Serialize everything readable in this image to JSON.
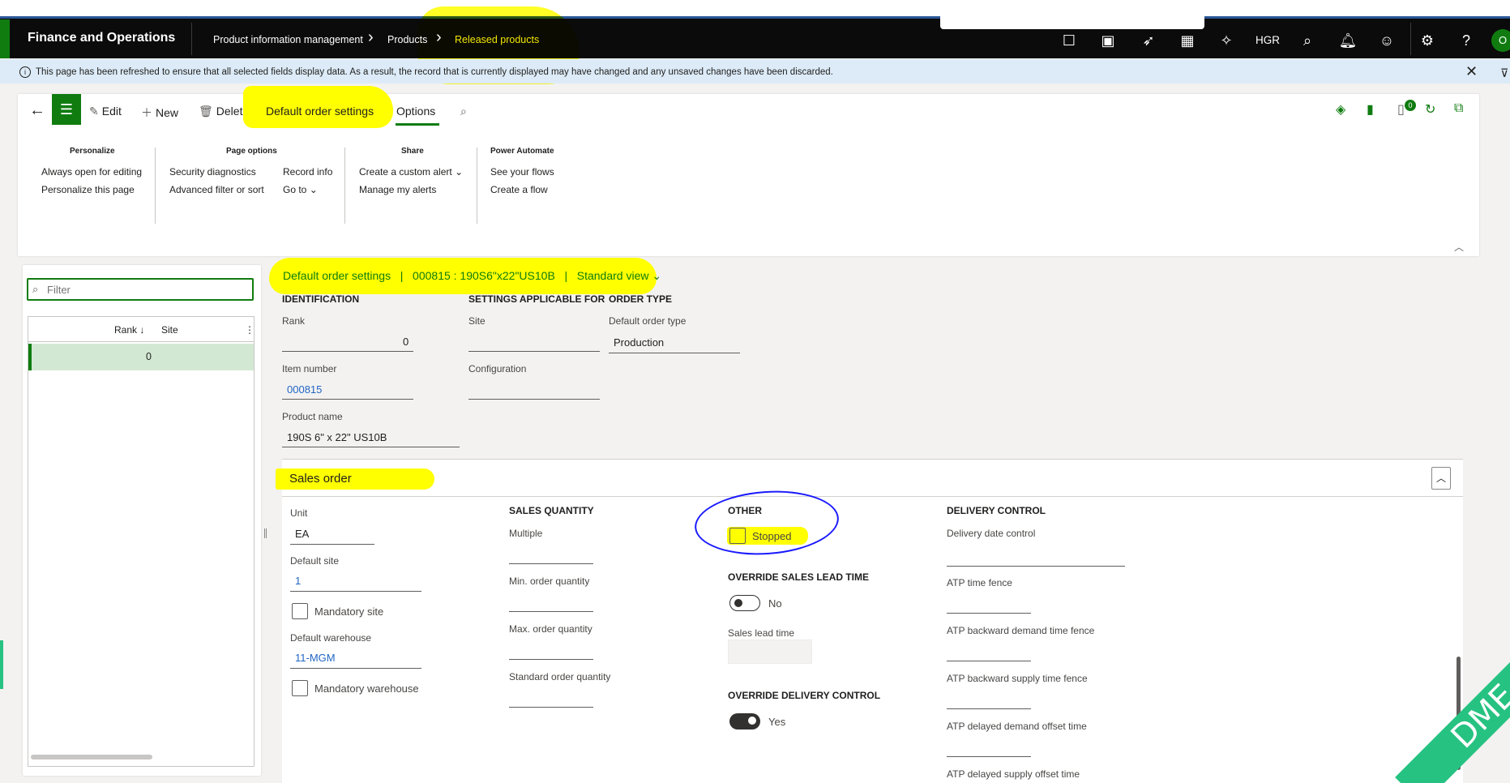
{
  "app": {
    "title": "Finance and Operations"
  },
  "breadcrumb": [
    {
      "label": "Product information management"
    },
    {
      "label": "Products"
    },
    {
      "label": "Released products"
    }
  ],
  "topbar": {
    "company": "HGR",
    "avatar": "O"
  },
  "infobar": {
    "message": "This page has been refreshed to ensure that all selected fields display data. As a result, the record that is currently displayed may have changed and any unsaved changes have been discarded."
  },
  "actionpane": {
    "edit": "Edit",
    "new": "New",
    "delete": "Delete",
    "tab_default_order_settings": "Default order settings",
    "tab_options": "Options",
    "badge": "0",
    "groups": {
      "personalize": {
        "title": "Personalize",
        "items": [
          "Always open for editing",
          "Personalize this page"
        ]
      },
      "page_options": {
        "title": "Page options",
        "items": [
          "Security diagnostics",
          "Advanced filter or sort",
          "Record info",
          "Go to"
        ]
      },
      "share": {
        "title": "Share",
        "items": [
          "Create a custom alert",
          "Manage my alerts"
        ]
      },
      "power_automate": {
        "title": "Power Automate",
        "items": [
          "See your flows",
          "Create a flow"
        ]
      }
    }
  },
  "list": {
    "filter_placeholder": "Filter",
    "columns": [
      "Rank",
      "Site"
    ],
    "rows": [
      {
        "rank": "0",
        "site": ""
      }
    ]
  },
  "form": {
    "title": "Default order settings   |   000815 : 190S6\"x22\"US10B   |   Standard view",
    "identification": {
      "header": "IDENTIFICATION",
      "rank_label": "Rank",
      "rank": "0",
      "item_label": "Item number",
      "item": "000815",
      "product_label": "Product name",
      "product": "190S 6\" x 22\" US10B"
    },
    "settings": {
      "header": "SETTINGS APPLICABLE FOR",
      "site_label": "Site",
      "site": "",
      "config_label": "Configuration",
      "config": ""
    },
    "order_type": {
      "header": "ORDER TYPE",
      "label": "Default order type",
      "value": "Production"
    }
  },
  "sales_order": {
    "title": "Sales order",
    "unit_label": "Unit",
    "unit": "EA",
    "default_site_label": "Default site",
    "default_site": "1",
    "mandatory_site": "Mandatory site",
    "default_warehouse_label": "Default warehouse",
    "default_warehouse": "11-MGM",
    "mandatory_warehouse": "Mandatory warehouse",
    "sales_quantity": {
      "header": "SALES QUANTITY",
      "multiple": "Multiple",
      "min": "Min. order quantity",
      "max": "Max. order quantity",
      "standard": "Standard order quantity"
    },
    "other": {
      "header": "OTHER",
      "stopped": "Stopped",
      "stopped_checked": false
    },
    "override_lead": {
      "header": "OVERRIDE SALES LEAD TIME",
      "toggle": "No",
      "lead_time_label": "Sales lead time"
    },
    "override_delivery": {
      "header": "OVERRIDE DELIVERY CONTROL",
      "toggle": "Yes"
    },
    "delivery_control": {
      "header": "DELIVERY CONTROL",
      "date_control": "Delivery date control",
      "atp_fence": "ATP time fence",
      "atp_backward_demand": "ATP backward demand time fence",
      "atp_backward_supply": "ATP backward supply time fence",
      "atp_delayed_demand": "ATP delayed demand offset time",
      "atp_delayed_supply": "ATP delayed supply offset time"
    }
  },
  "watermark": "DME",
  "colors": {
    "accent": "#107c10",
    "highlight": "#ffff00",
    "link": "#2266c4",
    "annotation": "#1a1aff"
  }
}
